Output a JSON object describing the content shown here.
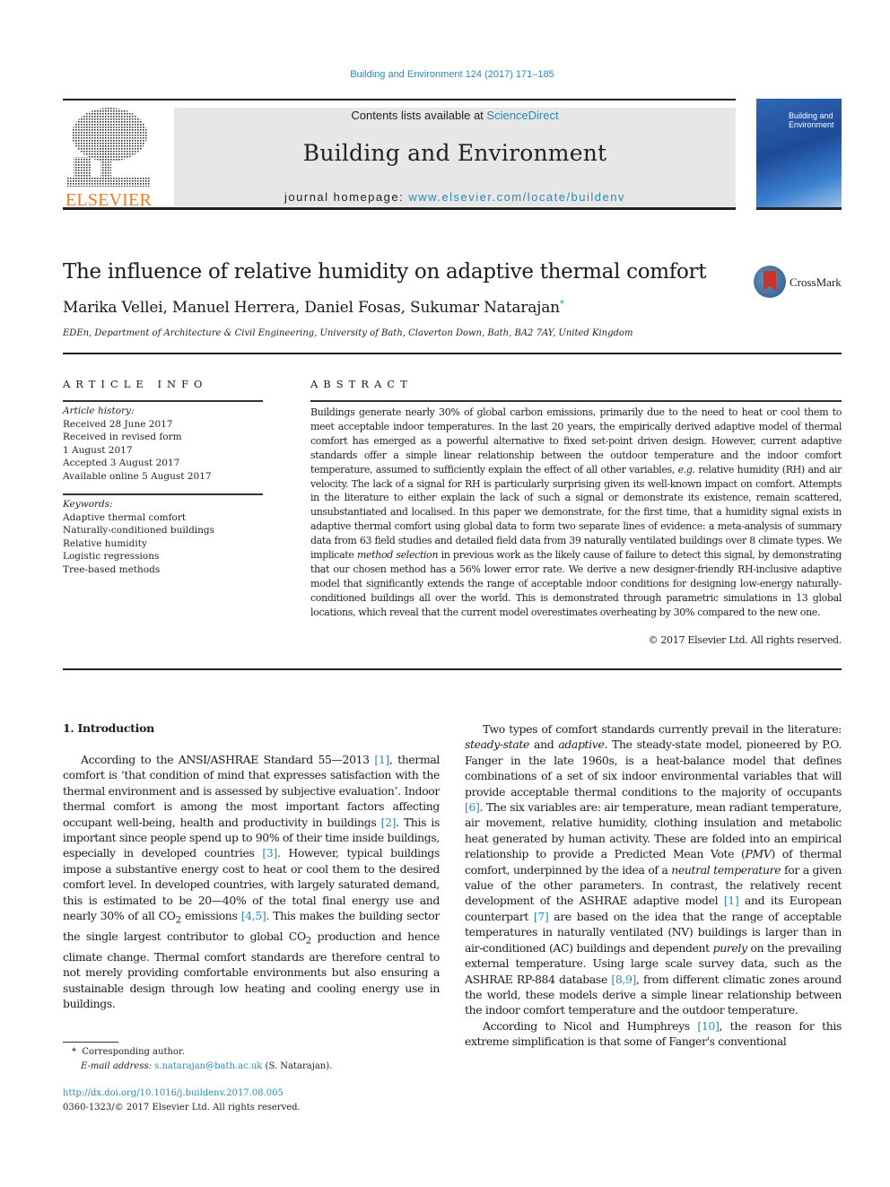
{
  "journal_ref": "Building and Environment 124 (2017) 171–185",
  "banner": {
    "contents_prefix": "Contents lists available at ",
    "contents_link": "ScienceDirect",
    "journal_name": "Building and Environment",
    "homepage_prefix": "journal homepage: ",
    "homepage_link": "www.elsevier.com/locate/buildenv"
  },
  "publisher_logo": "ELSEVIER",
  "cover": {
    "title_line1": "Building and",
    "title_line2": "Environment"
  },
  "article": {
    "title": "The influence of relative humidity on adaptive thermal comfort",
    "authors": "Marika Vellei, Manuel Herrera, Daniel Fosas, Sukumar Natarajan",
    "corresponding_mark": "*",
    "affiliation": "EDEn, Department of Architecture & Civil Engineering, University of Bath, Claverton Down, Bath, BA2 7AY, United Kingdom",
    "crossmark_label": "CrossMark"
  },
  "article_info": {
    "heading": "ARTICLE INFO",
    "history_label": "Article history:",
    "history": [
      "Received 28 June 2017",
      "Received in revised form",
      "1 August 2017",
      "Accepted 3 August 2017",
      "Available online 5 August 2017"
    ],
    "keywords_label": "Keywords:",
    "keywords": [
      "Adaptive thermal comfort",
      "Naturally-conditioned buildings",
      "Relative humidity",
      "Logistic regressions",
      "Tree-based methods"
    ]
  },
  "abstract": {
    "heading": "ABSTRACT",
    "part1": "Buildings generate nearly 30% of global carbon emissions, primarily due to the need to heat or cool them to meet acceptable indoor temperatures. In the last 20 years, the empirically derived adaptive model of thermal comfort has emerged as a powerful alternative to fixed set-point driven design. However, current adaptive standards offer a simple linear relationship between the outdoor temperature and the indoor comfort temperature, assumed to sufficiently explain the effect of all other variables, ",
    "eg": "e.g.",
    "part2": " relative humidity (RH) and air velocity. The lack of a signal for RH is particularly surprising given its well-known impact on comfort. Attempts in the literature to either explain the lack of such a signal or demonstrate its existence, remain scattered, unsubstantiated and localised. In this paper we demonstrate, for the first time, that a humidity signal exists in adaptive thermal comfort using global data to form two separate lines of evidence: a meta-analysis of summary data from 63 field studies and detailed field data from 39 naturally ventilated buildings over 8 climate types. We implicate ",
    "method_selection": "method selection",
    "part3": " in previous work as the likely cause of failure to detect this signal, by demonstrating that our chosen method has a 56% lower error rate. We derive a new designer-friendly RH-inclusive adaptive model that significantly extends the range of acceptable indoor conditions for designing low-energy naturally-conditioned buildings all over the world. This is demonstrated through parametric simulations in 13 global locations, which reveal that the current model overestimates overheating by 30% compared to the new one.",
    "copyright": "© 2017 Elsevier Ltd. All rights reserved."
  },
  "intro": {
    "section_title": "1.  Introduction",
    "left_p1": {
      "a": "According to the ANSI/ASHRAE Standard 55—2013 ",
      "ref1": "[1]",
      "b": ", thermal comfort is ‘that condition of mind that expresses satisfaction with the thermal environment and is assessed by subjective evaluation’. Indoor thermal comfort is among the most important factors affecting occupant well-being, health and productivity in buildings ",
      "ref2": "[2]",
      "c": ". This is important since people spend up to 90% of their time inside buildings, especially in developed countries ",
      "ref3": "[3]",
      "d": ". However, typical buildings impose a substantive energy cost to heat or cool them to the desired comfort level. In developed countries, with largely saturated demand, this is estimated to be 20—40% of the total final energy use and nearly 30% of all CO",
      "sub": "2",
      "e": " emissions ",
      "ref4": "[4,5]",
      "f": ". This makes the building sector the single largest contributor to global CO",
      "g": " production and hence climate change. Thermal comfort standards are therefore central to not merely providing comfortable environments but also ensuring a sustainable design through low heating and cooling energy use in buildings."
    },
    "right_p1": {
      "a": "Two types of comfort standards currently prevail in the literature: ",
      "steady": "steady-state",
      "and": " and ",
      "adaptive": "adaptive",
      "b": ". The steady-state model, pioneered by P.O. Fanger in the late 1960s, is a heat-balance model that defines combinations of a set of six indoor environmental variables that will provide acceptable thermal conditions to the majority of occupants ",
      "ref6": "[6]",
      "c": ". The six variables are: air temperature, mean radiant temperature, air movement, relative humidity, clothing insulation and metabolic heat generated by human activity. These are folded into an empirical relationship to provide a Predicted Mean Vote (",
      "pmv": "PMV",
      "d": ") of thermal comfort, underpinned by the idea of a ",
      "neutral": "neutral temperature",
      "e": " for a given value of the other parameters. In contrast, the relatively recent development of the ASHRAE adaptive model ",
      "ref1": "[1]",
      "f": " and its European counterpart ",
      "ref7": "[7]",
      "g": " are based on the idea that the range of acceptable temperatures in naturally ventilated (NV) buildings is larger than in air-conditioned (AC) buildings and dependent ",
      "purely": "purely",
      "h": " on the prevailing external temperature. Using large scale survey data, such as the ASHRAE RP-884 database ",
      "ref89": "[8,9]",
      "i": ", from different climatic zones around the world, these models derive a simple linear relationship between the indoor comfort temperature and the outdoor temperature."
    },
    "right_p2": {
      "a": "According to Nicol and Humphreys ",
      "ref10": "[10]",
      "b": ", the reason for this extreme simplification is that some of Fanger's conventional"
    }
  },
  "footnote": {
    "mark": "*",
    "corresponding": "Corresponding author.",
    "email_label": "E-mail address:",
    "email": "s.natarajan@bath.ac.uk",
    "email_name": "(S. Natarajan)."
  },
  "doi": {
    "link": "http://dx.doi.org/10.1016/j.buildenv.2017.08.005",
    "issn_copyright": "0360-1323/© 2017 Elsevier Ltd. All rights reserved."
  }
}
